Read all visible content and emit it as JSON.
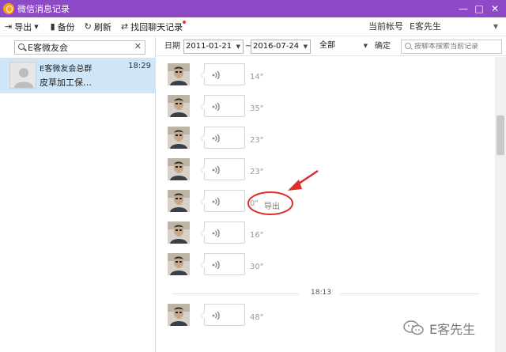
{
  "window": {
    "title": "微信消息记录",
    "app_icon": "wechat-history-icon",
    "controls": [
      "minimize",
      "maximize",
      "close"
    ]
  },
  "toolbar": {
    "export_label": "导出",
    "backup_label": "备份",
    "refresh_label": "刷新",
    "recover_label": "找回聊天记录",
    "account_label": "当前帐号",
    "account_value": "E客先生"
  },
  "sidebar": {
    "search_value": "E客微友会",
    "conversations": [
      {
        "name": "E客微友会总群",
        "time": "18:29",
        "preview": "皮草加工保…"
      }
    ]
  },
  "filter": {
    "date_label": "日期",
    "start_date": "2011-01-21",
    "date_sep": "~",
    "end_date": "2016-07-24",
    "type_value": "全部",
    "confirm_label": "确定",
    "search_placeholder": "按聊本搜索当前记录"
  },
  "messages": [
    {
      "duration": "14\""
    },
    {
      "duration": "35\""
    },
    {
      "duration": "23\""
    },
    {
      "duration": "23\""
    },
    {
      "duration": "0\""
    },
    {
      "duration": "16\""
    },
    {
      "duration": "30\""
    },
    {
      "duration": "48\""
    }
  ],
  "time_separator": "18:13",
  "context_popup": {
    "label": "导出"
  },
  "annotation_color": "#e02c2c",
  "watermark": {
    "text": "E客先生"
  },
  "colors": {
    "titlebar": "#8e49c7",
    "selected_row": "#cfe6f8"
  }
}
